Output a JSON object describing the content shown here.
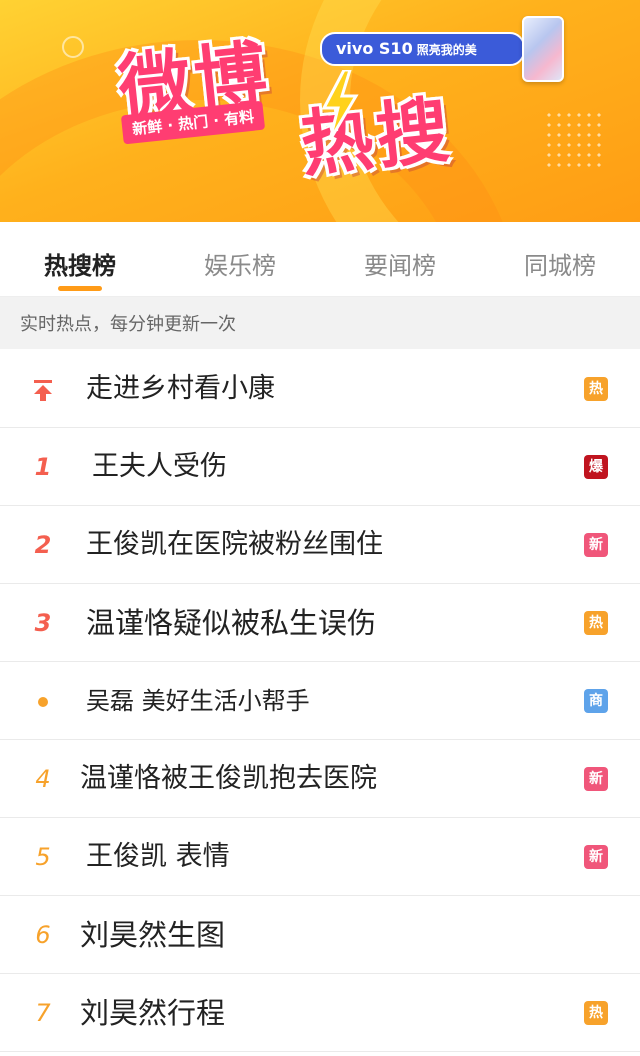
{
  "banner": {
    "logo_top": "微博",
    "logo_bottom": "热搜",
    "slogan": "新鲜 · 热门 · 有料",
    "ad_brand": "vivo S10",
    "ad_text": "照亮我的美"
  },
  "tabs": [
    {
      "label": "热搜榜",
      "active": true
    },
    {
      "label": "娱乐榜",
      "active": false
    },
    {
      "label": "要闻榜",
      "active": false
    },
    {
      "label": "同城榜",
      "active": false
    }
  ],
  "subheader": "实时热点，每分钟更新一次",
  "colors": {
    "hot": "#f7a22b",
    "boom": "#c0141f",
    "new": "#f0567a",
    "ad": "#5ea3ea",
    "rank_top": "#f45f4f",
    "rank_norm": "#f7a22b",
    "tab_indicator": "#ff9b17"
  },
  "list": [
    {
      "rank": "",
      "rank_icon": "pin-top-icon",
      "title": "走进乡村看小康",
      "badge": "热",
      "badge_type": "hot"
    },
    {
      "rank": "1",
      "title": "王夫人受伤",
      "badge": "爆",
      "badge_type": "boom"
    },
    {
      "rank": "2",
      "title": "王俊凯在医院被粉丝围住",
      "badge": "新",
      "badge_type": "new"
    },
    {
      "rank": "3",
      "title": "温谨恪疑似被私生误伤",
      "badge": "热",
      "badge_type": "hot"
    },
    {
      "rank": "",
      "rank_icon": "dot-icon",
      "title": "吴磊 美好生活小帮手",
      "badge": "商",
      "badge_type": "ad"
    },
    {
      "rank": "4",
      "title": "温谨恪被王俊凯抱去医院",
      "badge": "新",
      "badge_type": "new"
    },
    {
      "rank": "5",
      "title": "王俊凯 表情",
      "badge": "新",
      "badge_type": "new"
    },
    {
      "rank": "6",
      "title": "刘昊然生图",
      "badge": "",
      "badge_type": ""
    },
    {
      "rank": "7",
      "title": "刘昊然行程",
      "badge": "热",
      "badge_type": "hot"
    }
  ]
}
